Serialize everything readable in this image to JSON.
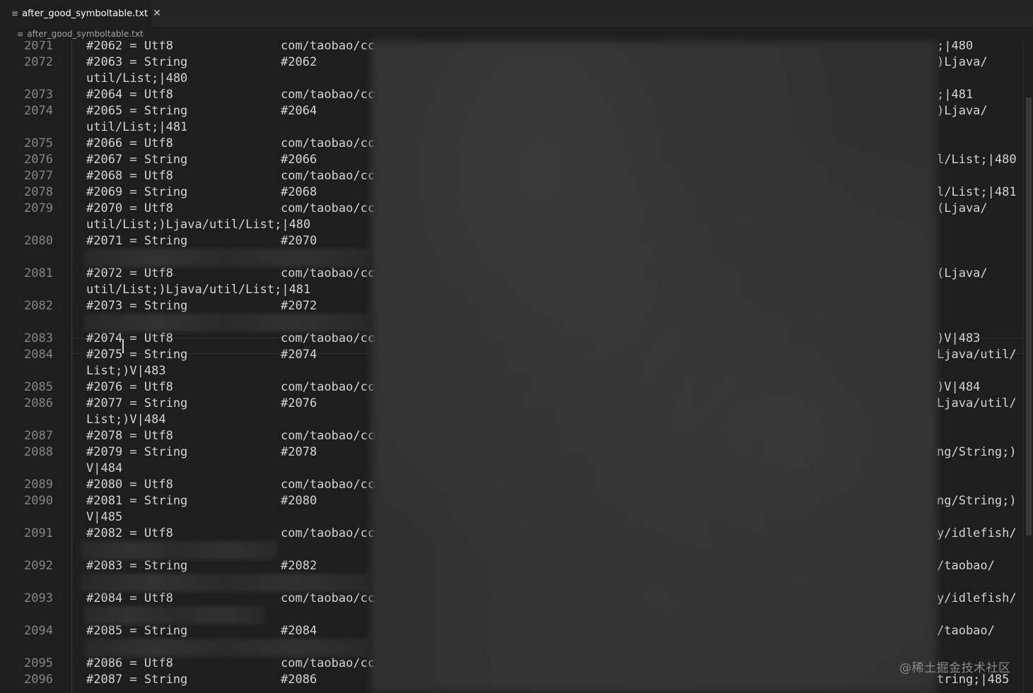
{
  "tab": {
    "title": "after_good_symboltable.txt",
    "file_icon": "≡",
    "close_icon": "✕"
  },
  "breadcrumb": {
    "file_icon": "≡",
    "label": "after_good_symboltable.txt"
  },
  "gutter": [
    {
      "n": "2071",
      "row": 0
    },
    {
      "n": "2072",
      "row": 1
    },
    {
      "n": "2073",
      "row": 3
    },
    {
      "n": "2074",
      "row": 4
    },
    {
      "n": "2075",
      "row": 6
    },
    {
      "n": "2076",
      "row": 7
    },
    {
      "n": "2077",
      "row": 8
    },
    {
      "n": "2078",
      "row": 9
    },
    {
      "n": "2079",
      "row": 10
    },
    {
      "n": "2080",
      "row": 12
    },
    {
      "n": "2081",
      "row": 14
    },
    {
      "n": "2082",
      "row": 16
    },
    {
      "n": "2083",
      "row": 18
    },
    {
      "n": "2084",
      "row": 19
    },
    {
      "n": "2085",
      "row": 21
    },
    {
      "n": "2086",
      "row": 22
    },
    {
      "n": "2087",
      "row": 24
    },
    {
      "n": "2088",
      "row": 25
    },
    {
      "n": "2089",
      "row": 27
    },
    {
      "n": "2090",
      "row": 28
    },
    {
      "n": "2091",
      "row": 30
    },
    {
      "n": "2092",
      "row": 32
    },
    {
      "n": "2093",
      "row": 34
    },
    {
      "n": "2094",
      "row": 36
    },
    {
      "n": "2095",
      "row": 38
    },
    {
      "n": "2096",
      "row": 39
    }
  ],
  "rows": [
    {
      "row": 0,
      "c1": "#2062 = Utf8",
      "c2": "com/taobao/cc",
      "c3": ";|480"
    },
    {
      "row": 1,
      "c1": "#2063 = String",
      "c2": "#2062",
      "c3": ")Ljava/"
    },
    {
      "row": 2,
      "c1": "util/List;|480",
      "c2": "",
      "c3": ""
    },
    {
      "row": 3,
      "c1": "#2064 = Utf8",
      "c2": "com/taobao/cc",
      "c3": ";|481"
    },
    {
      "row": 4,
      "c1": "#2065 = String",
      "c2": "#2064",
      "c3": ")Ljava/"
    },
    {
      "row": 5,
      "c1": "util/List;|481",
      "c2": "",
      "c3": ""
    },
    {
      "row": 6,
      "c1": "#2066 = Utf8",
      "c2": "com/taobao/cc",
      "c3": ""
    },
    {
      "row": 7,
      "c1": "#2067 = String",
      "c2": "#2066",
      "c3": "l/List;|480"
    },
    {
      "row": 8,
      "c1": "#2068 = Utf8",
      "c2": "com/taobao/cc",
      "c3": ""
    },
    {
      "row": 9,
      "c1": "#2069 = String",
      "c2": "#2068",
      "c3": "l/List;|481"
    },
    {
      "row": 10,
      "c1": "#2070 = Utf8",
      "c2": "com/taobao/cc",
      "c3": "(Ljava/"
    },
    {
      "row": 11,
      "c1": "util/List;)Ljava/util/List;|480",
      "c2": "",
      "c3": ""
    },
    {
      "row": 12,
      "c1": "#2071 = String",
      "c2": "#2070",
      "c3": ""
    },
    {
      "row": 14,
      "c1": "#2072 = Utf8",
      "c2": "com/taobao/cc",
      "c3": "(Ljava/"
    },
    {
      "row": 15,
      "c1": "util/List;)Ljava/util/List;|481",
      "c2": "",
      "c3": ""
    },
    {
      "row": 16,
      "c1": "#2073 = String",
      "c2": "#2072",
      "c3": ""
    },
    {
      "row": 18,
      "c1": "#2074 = Utf8",
      "c2": "com/taobao/cc",
      "c3": ")V|483"
    },
    {
      "row": 19,
      "c1": "#2075 = String",
      "c2": "#2074",
      "c3": "Ljava/util/"
    },
    {
      "row": 20,
      "c1": "List;)V|483",
      "c2": "",
      "c3": ""
    },
    {
      "row": 21,
      "c1": "#2076 = Utf8",
      "c2": "com/taobao/cc",
      "c3": ")V|484"
    },
    {
      "row": 22,
      "c1": "#2077 = String",
      "c2": "#2076",
      "c3": "Ljava/util/"
    },
    {
      "row": 23,
      "c1": "List;)V|484",
      "c2": "",
      "c3": ""
    },
    {
      "row": 24,
      "c1": "#2078 = Utf8",
      "c2": "com/taobao/cc",
      "c3": ""
    },
    {
      "row": 25,
      "c1": "#2079 = String",
      "c2": "#2078",
      "c3": "ng/String;)"
    },
    {
      "row": 26,
      "c1": "V|484",
      "c2": "",
      "c3": ""
    },
    {
      "row": 27,
      "c1": "#2080 = Utf8",
      "c2": "com/taobao/cc",
      "c3": ""
    },
    {
      "row": 28,
      "c1": "#2081 = String",
      "c2": "#2080",
      "c3": "ng/String;)"
    },
    {
      "row": 29,
      "c1": "V|485",
      "c2": "",
      "c3": ""
    },
    {
      "row": 30,
      "c1": "#2082 = Utf8",
      "c2": "com/taobao/cc",
      "c3": "y/idlefish/"
    },
    {
      "row": 32,
      "c1": "#2083 = String",
      "c2": "#2082",
      "c3": "/taobao/"
    },
    {
      "row": 34,
      "c1": "#2084 = Utf8",
      "c2": "com/taobao/cc",
      "c3": "y/idlefish/"
    },
    {
      "row": 36,
      "c1": "#2085 = String",
      "c2": "#2084",
      "c3": "/taobao/"
    },
    {
      "row": 38,
      "c1": "#2086 = Utf8",
      "c2": "com/taobao/cc",
      "c3": ""
    },
    {
      "row": 39,
      "c1": "#2087 = String",
      "c2": "#2086",
      "c3": "tring;|485"
    }
  ],
  "watermark": "@稀土掘金技术社区",
  "colors": {
    "background": "#1e1e1e",
    "text": "#d4d4d4",
    "line_number": "#858585",
    "tab_bar": "#252526"
  }
}
